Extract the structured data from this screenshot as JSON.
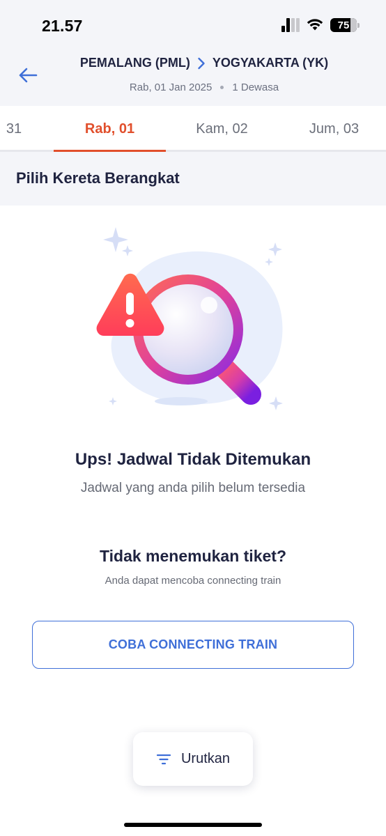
{
  "status_bar": {
    "time": "21.57",
    "battery_level": "75"
  },
  "header": {
    "origin": "PEMALANG (PML)",
    "destination": "YOGYAKARTA (YK)",
    "date": "Rab, 01 Jan 2025",
    "passengers": "1 Dewasa"
  },
  "date_tabs": [
    {
      "label": "31",
      "active": false
    },
    {
      "label": "Rab, 01",
      "active": true
    },
    {
      "label": "Kam, 02",
      "active": false
    },
    {
      "label": "Jum, 03",
      "active": false
    }
  ],
  "section": {
    "title": "Pilih Kereta Berangkat"
  },
  "empty_state": {
    "title": "Ups! Jadwal Tidak Ditemukan",
    "subtitle": "Jadwal yang anda pilih belum tersedia",
    "icon": "magnifier-warning-illustration"
  },
  "suggestion": {
    "title": "Tidak menemukan tiket?",
    "subtitle": "Anda dapat mencoba connecting train",
    "button_label": "COBA CONNECTING TRAIN"
  },
  "sort": {
    "label": "Urutkan",
    "icon": "filter-lines-icon"
  },
  "colors": {
    "accent_orange": "#e14f2c",
    "primary_blue": "#3f6fd8",
    "header_bg": "#f4f5f9",
    "text_dark": "#1f2340"
  }
}
